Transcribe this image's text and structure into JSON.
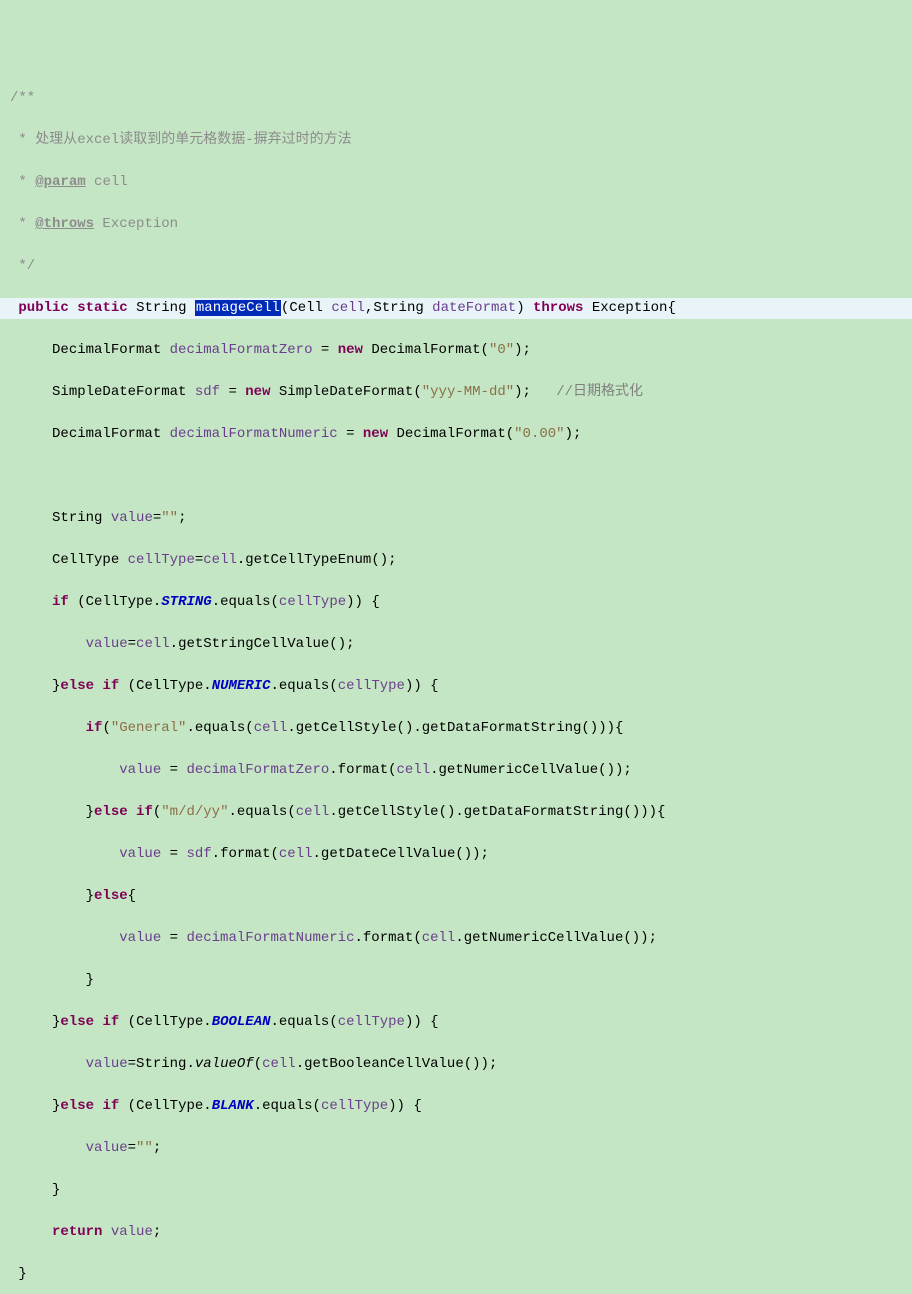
{
  "javadoc": {
    "open": "/**",
    "desc": " * 处理从excel读取到的单元格数据-摒弃过时的方法",
    "param_tag": "@param",
    "param_name": " cell",
    "throws_tag": "@throws",
    "throws_name": " Exception",
    "close": " */"
  },
  "sig": {
    "public": "public",
    "static": "static",
    "ret": "String",
    "name": "manageCell",
    "p1type": "Cell",
    "p1name": "cell",
    "p2type": "String",
    "p2name": "dateFormat",
    "throws": "throws",
    "exc": "Exception"
  },
  "l1": {
    "type": "DecimalFormat",
    "var": "decimalFormatZero",
    "new": "new",
    "ctor": "DecimalFormat",
    "arg": "\"0\""
  },
  "l2": {
    "type": "SimpleDateFormat",
    "var": "sdf",
    "new": "new",
    "ctor": "SimpleDateFormat",
    "arg": "\"yyy-MM-dd\"",
    "comment": "//日期格式化"
  },
  "l3": {
    "type": "DecimalFormat",
    "var": "decimalFormatNumeric",
    "new": "new",
    "ctor": "DecimalFormat",
    "arg": "\"0.00\""
  },
  "l4": {
    "type": "String",
    "var": "value",
    "val": "\"\""
  },
  "l5": {
    "type": "CellType",
    "var": "cellType",
    "param": "cell",
    "method": "getCellTypeEnum"
  },
  "l6": {
    "if": "if",
    "cls": "CellType",
    "field": "STRING",
    "equals": "equals",
    "arg": "cellType"
  },
  "l7": {
    "var": "value",
    "param": "cell",
    "method": "getStringCellValue"
  },
  "l8": {
    "else": "else",
    "if": "if",
    "cls": "CellType",
    "field": "NUMERIC",
    "equals": "equals",
    "arg": "cellType"
  },
  "l9": {
    "if": "if",
    "str": "\"General\"",
    "equals": "equals",
    "param": "cell",
    "m1": "getCellStyle",
    "m2": "getDataFormatString"
  },
  "l10": {
    "var": "value",
    "obj": "decimalFormatZero",
    "format": "format",
    "param": "cell",
    "method": "getNumericCellValue"
  },
  "l11": {
    "else": "else",
    "if": "if",
    "str": "\"m/d/yy\"",
    "equals": "equals",
    "param": "cell",
    "m1": "getCellStyle",
    "m2": "getDataFormatString"
  },
  "l12": {
    "var": "value",
    "obj": "sdf",
    "format": "format",
    "param": "cell",
    "method": "getDateCellValue"
  },
  "l13": {
    "else": "else"
  },
  "l14": {
    "var": "value",
    "obj": "decimalFormatNumeric",
    "format": "format",
    "param": "cell",
    "method": "getNumericCellValue"
  },
  "l15": {
    "else": "else",
    "if": "if",
    "cls": "CellType",
    "field": "BOOLEAN",
    "equals": "equals",
    "arg": "cellType"
  },
  "l16": {
    "var": "value",
    "cls": "String",
    "method": "valueOf",
    "param": "cell",
    "m2": "getBooleanCellValue"
  },
  "l17": {
    "else": "else",
    "if": "if",
    "cls": "CellType",
    "field": "BLANK",
    "equals": "equals",
    "arg": "cellType"
  },
  "l18": {
    "var": "value",
    "val": "\"\""
  },
  "l19": {
    "return": "return",
    "var": "value"
  }
}
